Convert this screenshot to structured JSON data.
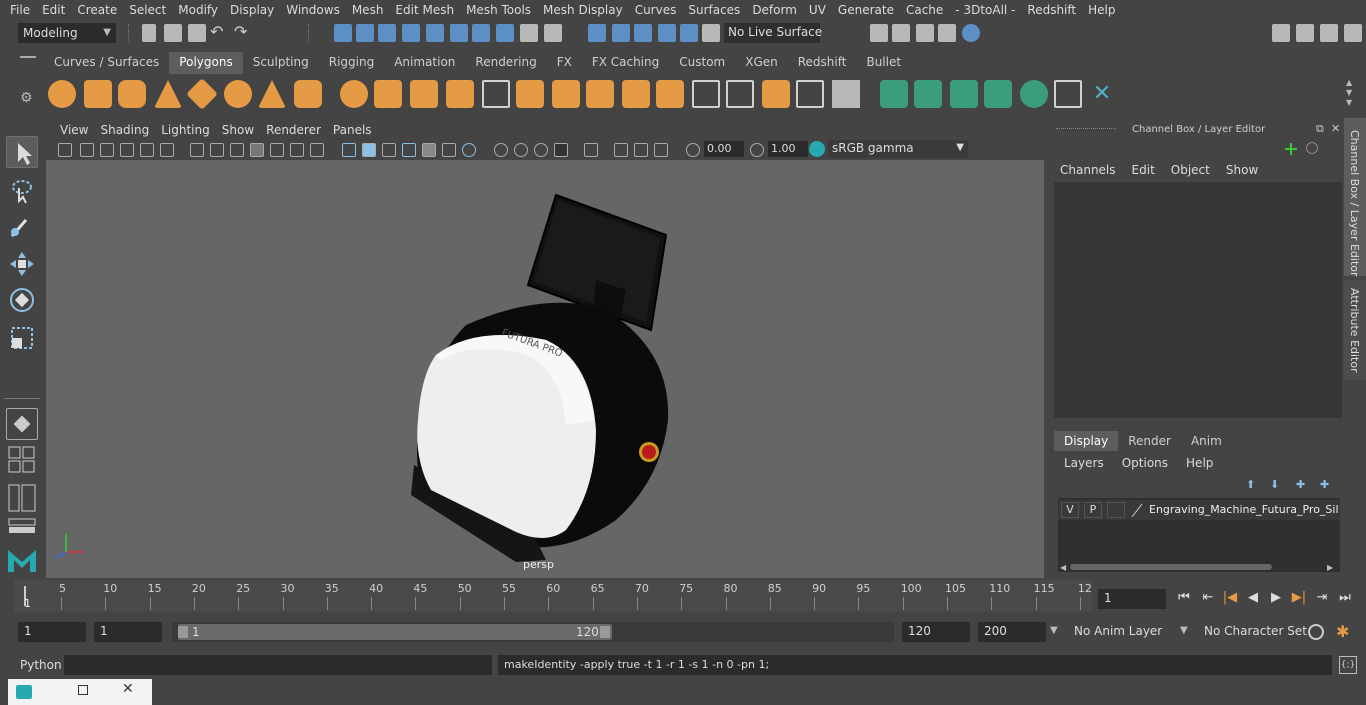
{
  "menu": [
    "File",
    "Edit",
    "Create",
    "Select",
    "Modify",
    "Display",
    "Windows",
    "Mesh",
    "Edit Mesh",
    "Mesh Tools",
    "Mesh Display",
    "Curves",
    "Surfaces",
    "Deform",
    "UV",
    "Generate",
    "Cache",
    "- 3DtoAll -",
    "Redshift",
    "Help"
  ],
  "status_line": {
    "mode": "Modeling",
    "live_surface": "No Live Surface"
  },
  "shelf": {
    "tabs": [
      "Curves / Surfaces",
      "Polygons",
      "Sculpting",
      "Rigging",
      "Animation",
      "Rendering",
      "FX",
      "FX Caching",
      "Custom",
      "XGen",
      "Redshift",
      "Bullet"
    ],
    "active_tab": "Polygons"
  },
  "viewport": {
    "menu": [
      "View",
      "Shading",
      "Lighting",
      "Show",
      "Renderer",
      "Panels"
    ],
    "exposure": "0.00",
    "gamma": "1.00",
    "color_space": "sRGB gamma",
    "camera_label": "persp",
    "model_brand": "FUTURA PRO"
  },
  "channel_box": {
    "title": "Channel Box / Layer Editor",
    "menu": [
      "Channels",
      "Edit",
      "Object",
      "Show"
    ],
    "side_tabs": [
      "Channel Box / Layer Editor",
      "Attribute Editor"
    ]
  },
  "layer_editor": {
    "tabs": [
      "Display",
      "Render",
      "Anim"
    ],
    "active_tab": "Display",
    "menu": [
      "Layers",
      "Options",
      "Help"
    ],
    "layer": {
      "v": "V",
      "p": "P",
      "name": "Engraving_Machine_Futura_Pro_Silca"
    }
  },
  "time_slider": {
    "ticks": [
      "5",
      "10",
      "15",
      "20",
      "25",
      "30",
      "35",
      "40",
      "45",
      "50",
      "55",
      "60",
      "65",
      "70",
      "75",
      "80",
      "85",
      "90",
      "95",
      "100",
      "105",
      "110",
      "115",
      "12"
    ],
    "start_marker": "1",
    "current_frame": "1"
  },
  "range": {
    "start": "1",
    "anim_start": "1",
    "slider_start": "1",
    "slider_end": "120",
    "end": "120",
    "anim_end": "200",
    "anim_layer": "No Anim Layer",
    "character_set": "No Character Set"
  },
  "command_line": {
    "language": "Python",
    "output": "makeIdentity -apply true -t 1 -r 1 -s 1 -n 0 -pn 1;"
  },
  "colors": {
    "ui_bg": "#444444",
    "viewport_bg": "#666666",
    "shelf_icon": "#e59a45",
    "accent": "#5d8fc7",
    "maya_logo": "#27a9b1"
  }
}
